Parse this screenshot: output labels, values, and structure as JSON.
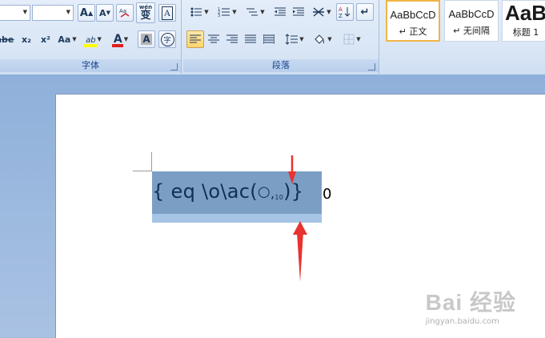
{
  "font_group": {
    "label": "字体",
    "grow_font": "A",
    "shrink_font": "A",
    "phonetic_guide": "wén",
    "phonetic_guide_char": "变",
    "char_border": "A",
    "strikethrough": "abe",
    "subscript": "x₂",
    "superscript": "x²",
    "change_case": "Aa",
    "highlight": "ab",
    "font_color": "A",
    "char_shading": "A",
    "enclose_char": "字"
  },
  "paragraph_group": {
    "label": "段落"
  },
  "styles": [
    {
      "sample": "AaBbCcD",
      "name": "↵ 正文"
    },
    {
      "sample": "AaBbCcD",
      "name": "↵ 无间隔"
    },
    {
      "sample": "AaB",
      "name": "标题 1"
    }
  ],
  "document": {
    "field_code_prefix": "{ eq \\o\\ac(",
    "circle": "○",
    "comma": ",",
    "subscript_num": "10",
    "field_code_suffix": ")}",
    "trailing_text": "0"
  },
  "watermark": {
    "brand": "Bai 经验",
    "url": "jingyan.baidu.com"
  },
  "colors": {
    "highlight_bar": "#ffff00",
    "font_color_bar": "#e01e1e",
    "selection": "#7b9fc4",
    "arrow": "#e8332f"
  }
}
